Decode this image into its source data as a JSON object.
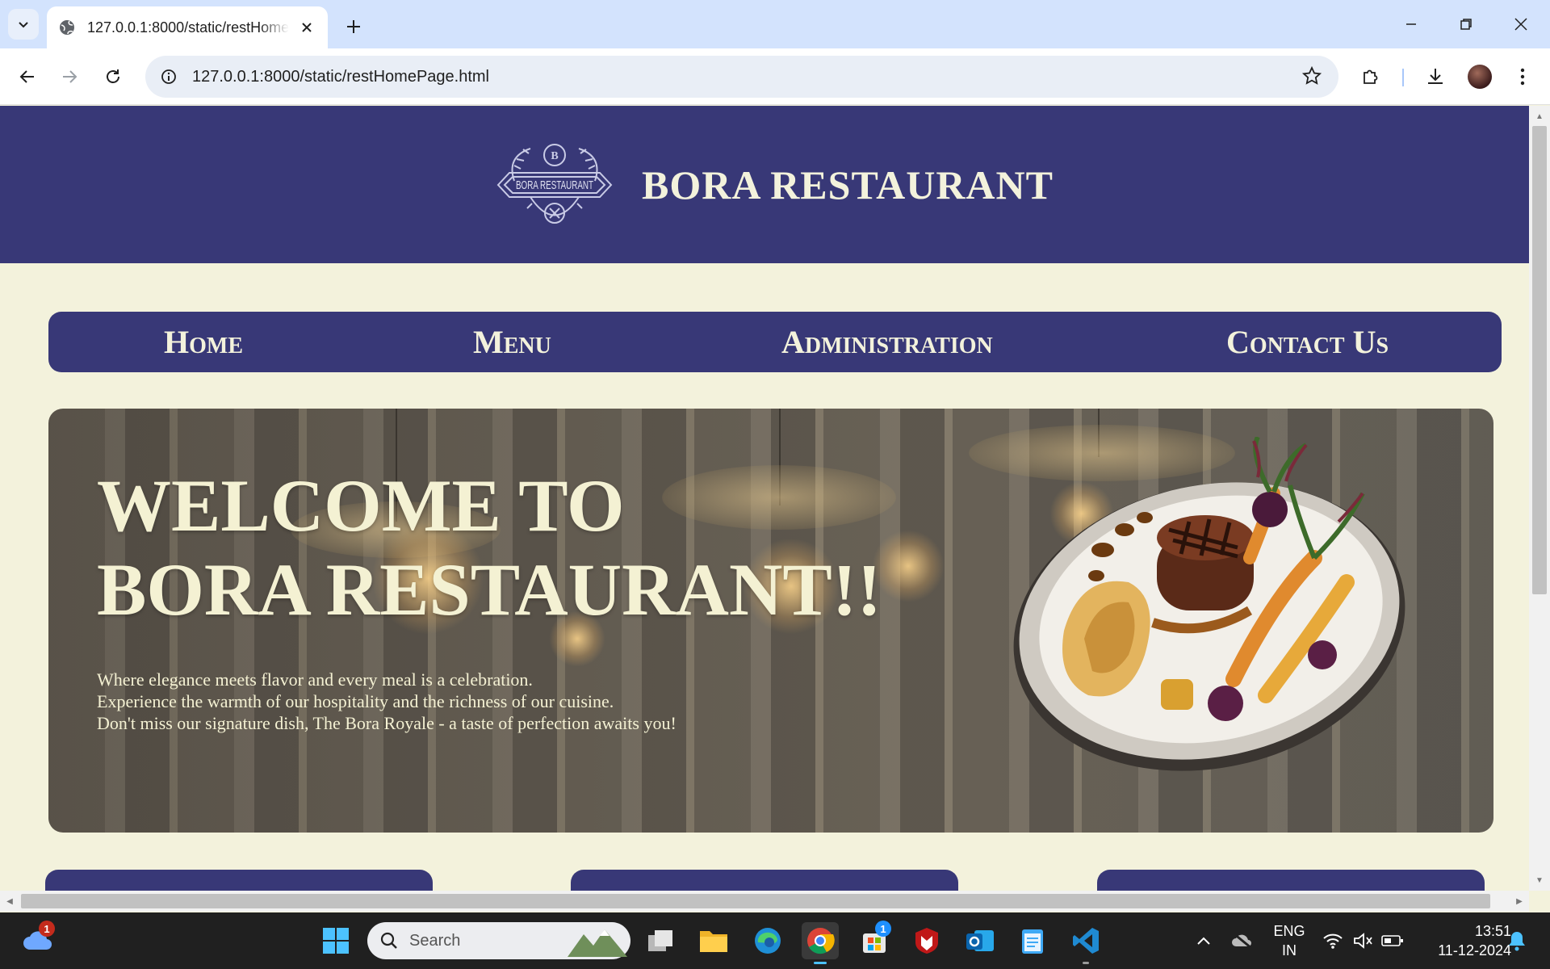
{
  "browser": {
    "tab_title": "127.0.0.1:8000/static/restHomePage.html",
    "url": "127.0.0.1:8000/static/restHomePage.html"
  },
  "site": {
    "title": "BORA RESTAURANT",
    "logo_letter": "B",
    "logo_text": "BORA RESTAURANT"
  },
  "nav": {
    "items": [
      {
        "label": "Home"
      },
      {
        "label": "Menu"
      },
      {
        "label": "Administration"
      },
      {
        "label": "Contact Us"
      }
    ]
  },
  "hero": {
    "title_line1": "WELCOME TO",
    "title_line2": "BORA RESTAURANT!!",
    "text_line1": "Where elegance meets flavor and every meal is a celebration.",
    "text_line2": "Experience the warmth of our hospitality and the richness of our cuisine.",
    "text_line3": "Don't miss our signature dish, The Bora Royale - a taste of perfection awaits you!"
  },
  "taskbar": {
    "search_placeholder": "Search",
    "weather_badge": "1",
    "store_badge": "1",
    "lang_line1": "ENG",
    "lang_line2": "IN",
    "time": "13:51",
    "date": "11-12-2024"
  },
  "colors": {
    "primary": "#383877",
    "cream": "#f3f2dc",
    "chrome_tab_bg": "#d3e3fd"
  }
}
